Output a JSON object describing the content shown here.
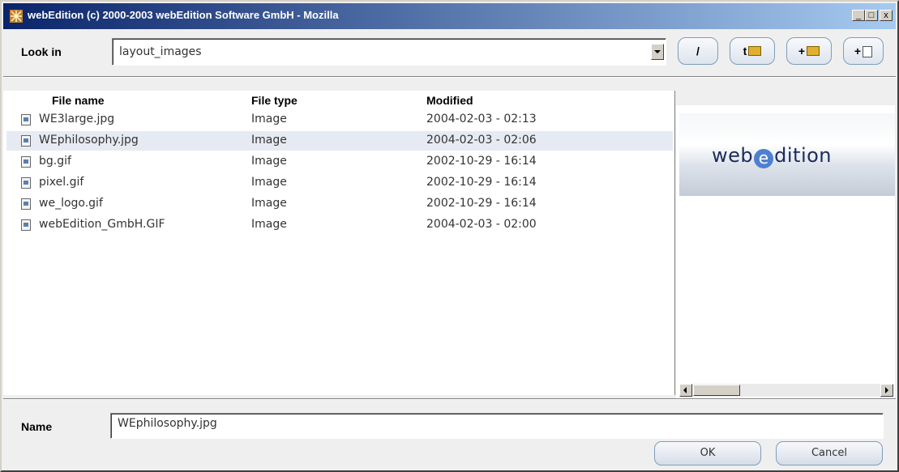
{
  "window": {
    "title": "webEdition (c) 2000-2003 webEdition Software GmbH - Mozilla",
    "minimize_label": "_",
    "maximize_label": "□",
    "close_label": "x"
  },
  "toolbar": {
    "look_in_label": "Look in",
    "look_in_value": "layout_images",
    "root_button_label": "/",
    "up_button_label": "t",
    "new_folder_button_label": "+",
    "new_file_button_label": "+"
  },
  "file_list": {
    "columns": [
      "File name",
      "File type",
      "Modified"
    ],
    "rows": [
      {
        "name": "WE3large.jpg",
        "type": "Image",
        "modified": "2004-02-03 - 02:13"
      },
      {
        "name": "WEphilosophy.jpg",
        "type": "Image",
        "modified": "2004-02-03 - 02:06"
      },
      {
        "name": "bg.gif",
        "type": "Image",
        "modified": "2002-10-29 - 16:14"
      },
      {
        "name": "pixel.gif",
        "type": "Image",
        "modified": "2002-10-29 - 16:14"
      },
      {
        "name": "we_logo.gif",
        "type": "Image",
        "modified": "2002-10-29 - 16:14"
      },
      {
        "name": "webEdition_GmbH.GIF",
        "type": "Image",
        "modified": "2004-02-03 - 02:00"
      }
    ],
    "selected_index": 1
  },
  "preview": {
    "logo_before": "web",
    "logo_e": "e",
    "logo_after": "dition"
  },
  "footer": {
    "name_label": "Name",
    "name_value": "WEphilosophy.jpg",
    "ok_label": "OK",
    "cancel_label": "Cancel"
  },
  "colors": {
    "titlebar_start": "#0a246a",
    "titlebar_end": "#a6caf0",
    "selection": "#e6eaf2",
    "dialog_background": "#efefef"
  }
}
